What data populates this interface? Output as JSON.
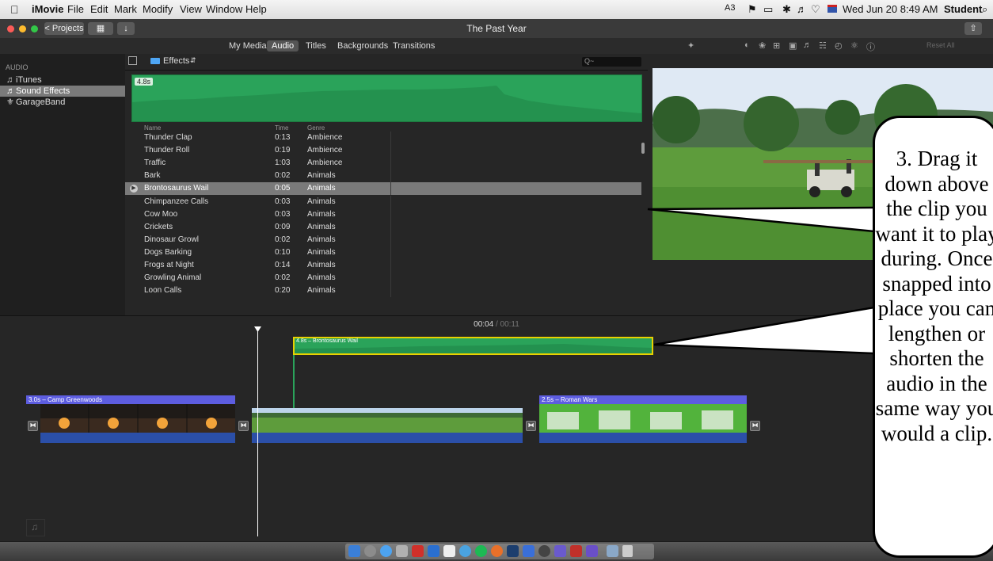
{
  "menubar": {
    "app_name": "iMovie",
    "menus": [
      "File",
      "Edit",
      "Mark",
      "Modify",
      "View",
      "Window",
      "Help"
    ],
    "status_items": {
      "adobe": "3",
      "datetime": "Wed Jun 20  8:49 AM",
      "user": "Student"
    }
  },
  "toolbar": {
    "projects_label": "< Projects",
    "window_title": "The Past Year"
  },
  "browser_tabs": [
    "My Media",
    "Audio",
    "Titles",
    "Backgrounds",
    "Transitions"
  ],
  "viewer": {
    "reset_label": "Reset All"
  },
  "sidebar": {
    "section_label": "AUDIO",
    "items": [
      {
        "label": "iTunes",
        "icon": "music-note-icon"
      },
      {
        "label": "Sound Effects",
        "icon": "speaker-icon",
        "selected": true
      },
      {
        "label": "GarageBand",
        "icon": "guitar-icon"
      }
    ]
  },
  "browser": {
    "folder_label": "Effects",
    "search_placeholder": "Q~",
    "preview_duration": "4.8s",
    "columns": [
      "Name",
      "Time",
      "Genre"
    ],
    "rows": [
      {
        "name": "Thunder Clap",
        "time": "0:13",
        "genre": "Ambience"
      },
      {
        "name": "Thunder Roll",
        "time": "0:19",
        "genre": "Ambience"
      },
      {
        "name": "Traffic",
        "time": "1:03",
        "genre": "Ambience"
      },
      {
        "name": "Bark",
        "time": "0:02",
        "genre": "Animals"
      },
      {
        "name": "Brontosaurus Wail",
        "time": "0:05",
        "genre": "Animals",
        "selected": true
      },
      {
        "name": "Chimpanzee Calls",
        "time": "0:03",
        "genre": "Animals"
      },
      {
        "name": "Cow Moo",
        "time": "0:03",
        "genre": "Animals"
      },
      {
        "name": "Crickets",
        "time": "0:09",
        "genre": "Animals"
      },
      {
        "name": "Dinosaur Growl",
        "time": "0:02",
        "genre": "Animals"
      },
      {
        "name": "Dogs Barking",
        "time": "0:10",
        "genre": "Animals"
      },
      {
        "name": "Frogs at Night",
        "time": "0:14",
        "genre": "Animals"
      },
      {
        "name": "Growling Animal",
        "time": "0:02",
        "genre": "Animals"
      },
      {
        "name": "Loon Calls",
        "time": "0:20",
        "genre": "Animals"
      }
    ]
  },
  "timeline": {
    "timecode_current": "00:04",
    "timecode_sep": " / ",
    "timecode_total": "00:11",
    "audio_clip_label": "4.8s – Brontosaurus Wail",
    "clip1_label": "3.0s – Camp Greenwoods",
    "clip3_label": "2.5s – Roman Wars",
    "transition_glyph": "⧓"
  },
  "callout": {
    "lines": [
      "3. Drag it",
      "down above",
      "the clip you",
      "want it to play",
      "during. Once",
      "snapped into",
      "place you can",
      "lengthen or",
      "shorten the",
      "audio in the",
      "same way you",
      "would a clip."
    ]
  },
  "colors": {
    "audio_green": "#2aa35a",
    "clip_label_purple": "#5d5de0",
    "selection_gray": "#7a7a7a",
    "playhead": "#ffffff"
  }
}
